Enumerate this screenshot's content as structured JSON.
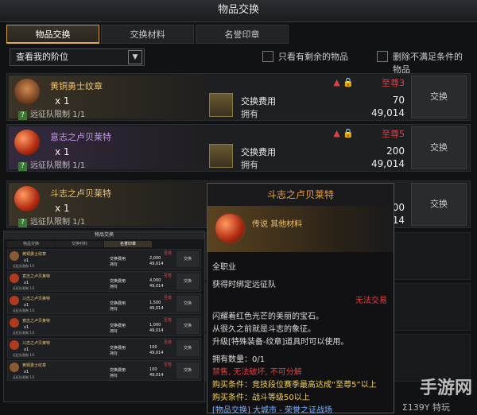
{
  "window": {
    "title": "物品交换"
  },
  "tabs": [
    {
      "label": "物品交换",
      "active": true
    },
    {
      "label": "交换材料",
      "active": false
    },
    {
      "label": "名誉印章",
      "active": false
    }
  ],
  "filter": {
    "select_value": "查看我的阶位",
    "check1_label": "只看有剩余的物品",
    "check2_label": "删除不满足条件的物品"
  },
  "rows": [
    {
      "name": "黄铜勇士纹章",
      "qty": "x 1",
      "limit": "远征队限制 1/1",
      "rank": "至尊3",
      "warn": "▲ 🔒",
      "cost_label": "交换费用",
      "own_label": "拥有",
      "cost": "70",
      "own": "49,014",
      "button": "交换"
    },
    {
      "name": "意志之卢贝莱特",
      "qty": "x 1",
      "limit": "远征队限制 1/1",
      "rank": "至尊5",
      "warn": "▲ 🔒",
      "cost_label": "交换费用",
      "own_label": "拥有",
      "cost": "200",
      "own": "49,014",
      "button": "交换"
    },
    {
      "name": "斗志之卢贝莱特",
      "qty": "x 1",
      "limit": "远征队限制 1/1",
      "rank": "",
      "warn": "",
      "cost_label": "交换费用",
      "own_label": "拥有",
      "cost": "200",
      "own": "49,014",
      "button": "交换"
    }
  ],
  "mini": {
    "title": "物品交换",
    "tabs": [
      "物品交换",
      "交换材料",
      "名誉印章"
    ],
    "rows": [
      {
        "name": "黄铜勇士纹章",
        "qty": "x1",
        "limit": "远征队限制 1/1",
        "cost": "2,000",
        "own": "49,014",
        "rank": "至尊",
        "button": "交换"
      },
      {
        "name": "意志之卢贝莱特",
        "qty": "x1",
        "limit": "远征队限制 1/1",
        "cost": "4,000",
        "own": "49,014",
        "rank": "至尊",
        "button": "交换"
      },
      {
        "name": "斗志之卢贝莱特",
        "qty": "x1",
        "limit": "远征队限制 1/1",
        "cost": "1,500",
        "own": "49,014",
        "rank": "至尊",
        "button": "交换"
      },
      {
        "name": "意志之卢贝莱特",
        "qty": "x1",
        "limit": "远征队限制 1/1",
        "cost": "1,000",
        "own": "49,014",
        "rank": "至尊",
        "button": "交换"
      },
      {
        "name": "斗志之卢贝莱特",
        "qty": "x1",
        "limit": "远征队限制 1/1",
        "cost": "100",
        "own": "49,014",
        "rank": "至尊",
        "button": "交换"
      },
      {
        "name": "黄铜勇士纹章",
        "qty": "x1",
        "limit": "远征队限制 1/1",
        "cost": "100",
        "own": "49,014",
        "rank": "至尊",
        "button": "交换"
      }
    ]
  },
  "tooltip": {
    "name": "斗志之卢贝莱特",
    "grade": "传说 其他材料",
    "class": "全职业",
    "bind": "获得时绑定远征队",
    "no_trade": "无法交易",
    "desc1": "闪耀着红色光芒的美丽的宝石。",
    "desc2": "从很久之前就是斗志的象征。",
    "desc3": "升级[特殊装备-纹章]道具时可以使用。",
    "count_label": "拥有数量：0/1",
    "restrict": "禁售, 无法破坏, 不可分解",
    "buy1": "购买条件：竞技段位赛季最高达成“至尊5”以上",
    "buy2": "购买条件：战斗等级50以上",
    "source": "[物品交换] 大城市 - 荣誉之证战场"
  },
  "watermark": {
    "main": "手游网",
    "sub": "Σ139Y 特玩"
  },
  "colors": {
    "legend": "#f0a040",
    "epic": "#c595f0",
    "warning": "#e04040"
  }
}
